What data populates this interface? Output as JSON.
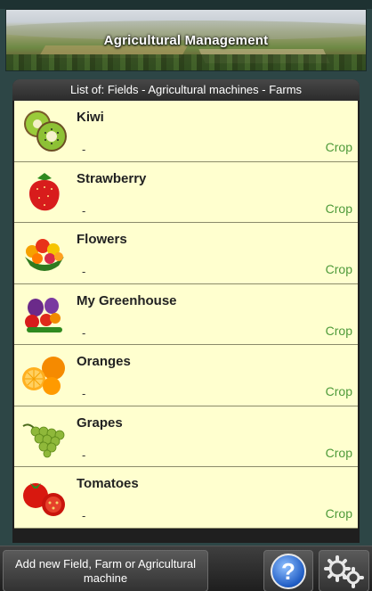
{
  "header": {
    "title": "Agricultural Management"
  },
  "list": {
    "title": "List of: Fields - Agricultural machines - Farms",
    "items": [
      {
        "name": "Kiwi",
        "sub": "-",
        "type": "Crop",
        "icon": "kiwi-icon"
      },
      {
        "name": "Strawberry",
        "sub": "-",
        "type": "Crop",
        "icon": "strawberry-icon"
      },
      {
        "name": "Flowers",
        "sub": "-",
        "type": "Crop",
        "icon": "flowers-icon"
      },
      {
        "name": "My Greenhouse",
        "sub": "-",
        "type": "Crop",
        "icon": "greenhouse-vegetables-icon"
      },
      {
        "name": "Oranges",
        "sub": "-",
        "type": "Crop",
        "icon": "oranges-icon"
      },
      {
        "name": "Grapes",
        "sub": "-",
        "type": "Crop",
        "icon": "grapes-icon"
      },
      {
        "name": "Tomatoes",
        "sub": "-",
        "type": "Crop",
        "icon": "tomatoes-icon"
      }
    ]
  },
  "bottom_bar": {
    "add_label": "Add new Field, Farm or Agricultural machine",
    "help_label": "?",
    "help_icon": "help-icon",
    "settings_icon": "gears-icon"
  },
  "colors": {
    "row_background": "#ffffcf",
    "type_text": "#4e9a3a",
    "app_background": "#2d4646"
  }
}
